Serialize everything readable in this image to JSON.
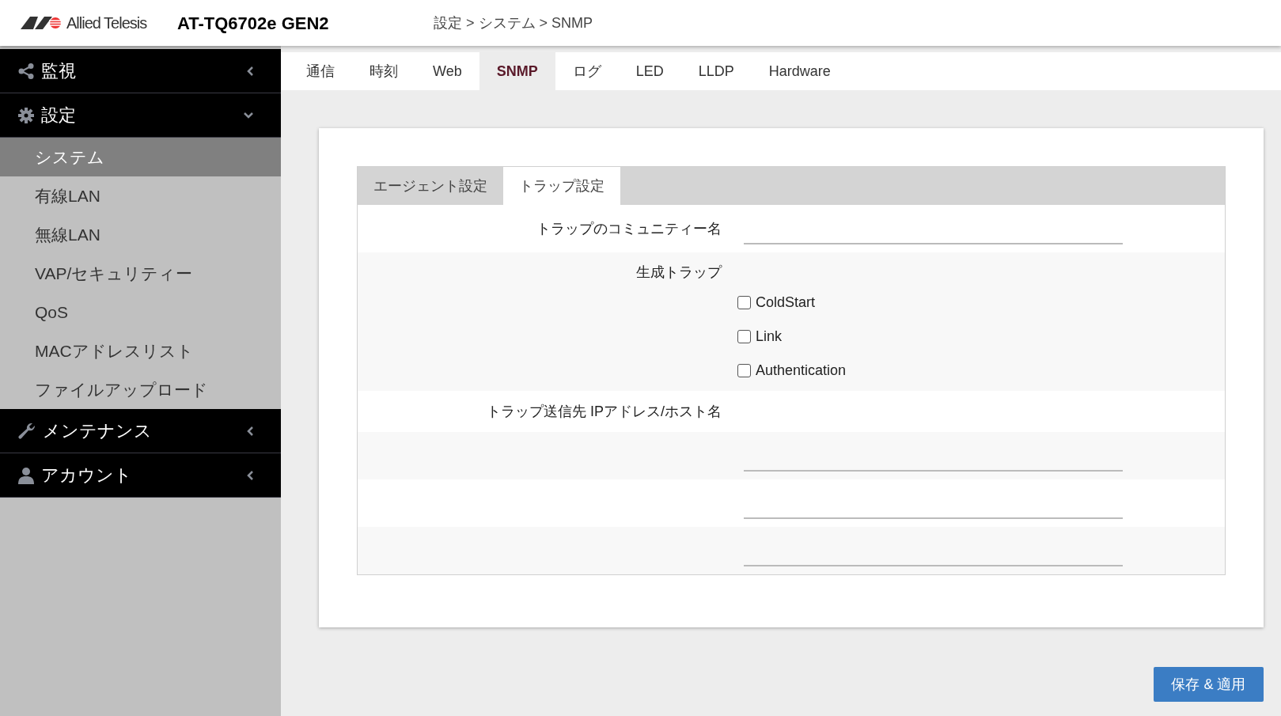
{
  "header": {
    "brand": "Allied Telesis",
    "model": "AT-TQ6702e GEN2",
    "breadcrumb": "設定 > システム > SNMP"
  },
  "sidebar": {
    "sections": [
      {
        "kind": "share",
        "label": "監視",
        "expanded": false
      },
      {
        "kind": "gear",
        "label": "設定",
        "expanded": true,
        "items": [
          {
            "label": "システム",
            "selected": true
          },
          {
            "label": "有線LAN",
            "selected": false
          },
          {
            "label": "無線LAN",
            "selected": false
          },
          {
            "label": "VAP/セキュリティー",
            "selected": false
          },
          {
            "label": "QoS",
            "selected": false
          },
          {
            "label": "MACアドレスリスト",
            "selected": false
          },
          {
            "label": "ファイルアップロード",
            "selected": false
          }
        ]
      },
      {
        "kind": "wrench",
        "label": "メンテナンス",
        "expanded": false
      },
      {
        "kind": "user",
        "label": "アカウント",
        "expanded": false
      }
    ]
  },
  "tabs": [
    {
      "label": "通信",
      "selected": false
    },
    {
      "label": "時刻",
      "selected": false
    },
    {
      "label": "Web",
      "selected": false
    },
    {
      "label": "SNMP",
      "selected": true
    },
    {
      "label": "ログ",
      "selected": false
    },
    {
      "label": "LED",
      "selected": false
    },
    {
      "label": "LLDP",
      "selected": false
    },
    {
      "label": "Hardware",
      "selected": false
    }
  ],
  "subtabs": [
    {
      "label": "エージェント設定",
      "selected": false
    },
    {
      "label": "トラップ設定",
      "selected": true
    }
  ],
  "form": {
    "community_label": "トラップのコミュニティー名",
    "traps_label": "生成トラップ",
    "traps": [
      {
        "label": "ColdStart",
        "checked": false
      },
      {
        "label": "Link",
        "checked": false
      },
      {
        "label": "Authentication",
        "checked": false
      }
    ],
    "hosts_label": "トラップ送信先 IPアドレス/ホスト名"
  },
  "save_button": "保存 & 適用"
}
